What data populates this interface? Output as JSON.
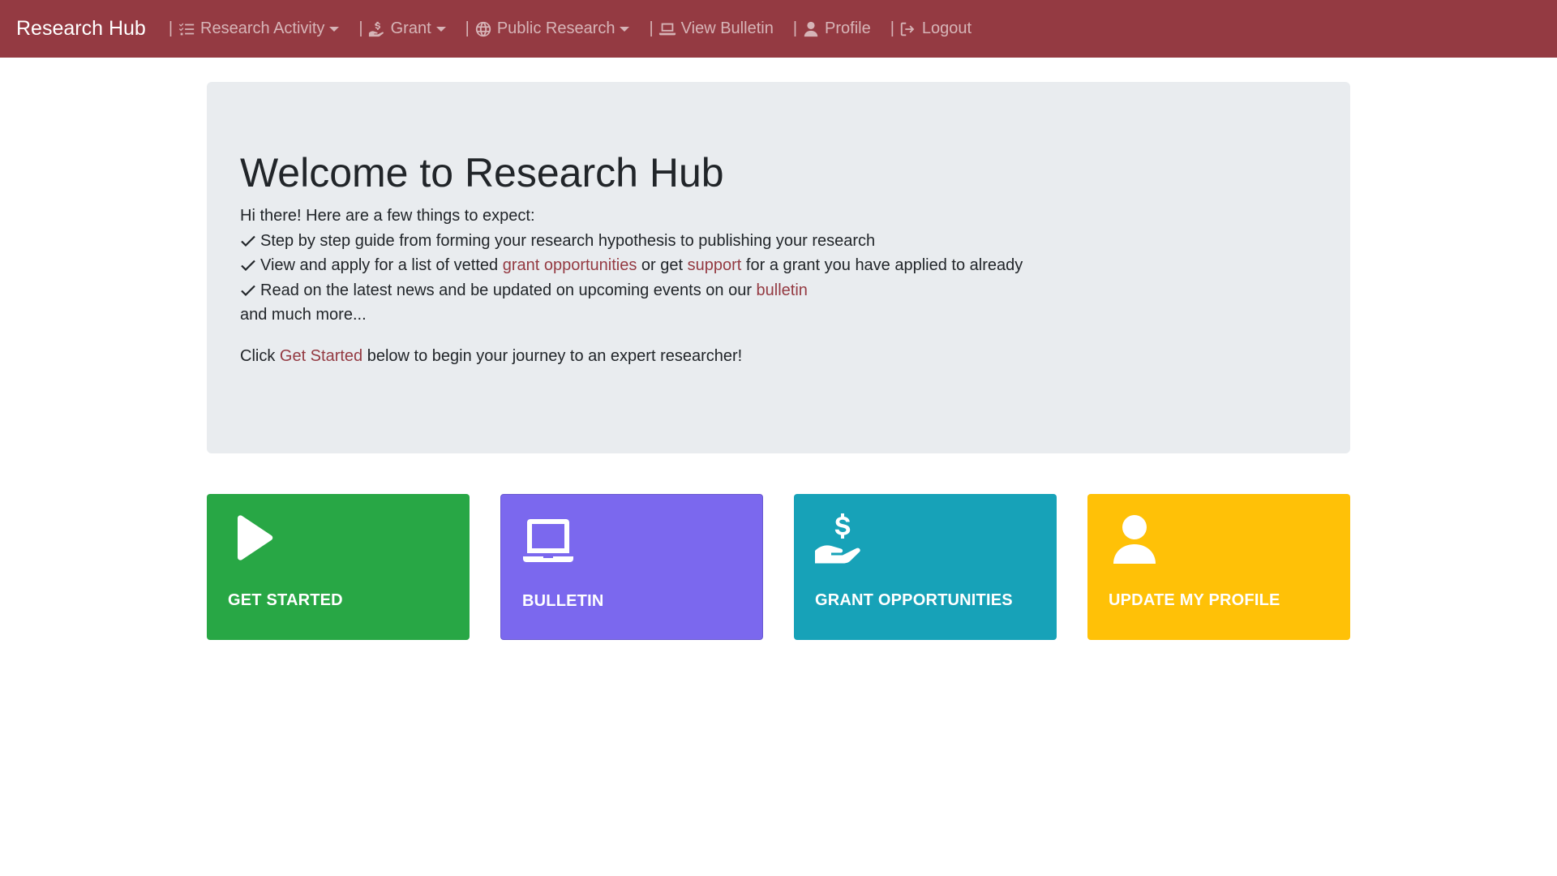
{
  "navbar": {
    "brand": "Research Hub",
    "separator": "|",
    "items": [
      {
        "label": "Research Activity",
        "icon": "list-check-icon",
        "dropdown": true
      },
      {
        "label": "Grant",
        "icon": "hand-dollar-icon",
        "dropdown": true
      },
      {
        "label": "Public Research",
        "icon": "globe-icon",
        "dropdown": true
      },
      {
        "label": "View Bulletin",
        "icon": "laptop-icon",
        "dropdown": false
      },
      {
        "label": "Profile",
        "icon": "user-icon",
        "dropdown": false
      },
      {
        "label": "Logout",
        "icon": "logout-icon",
        "dropdown": false
      }
    ]
  },
  "hero": {
    "title": "Welcome to Research Hub",
    "intro": "Hi there! Here are a few things to expect:",
    "bullet1": "Step by step guide from forming your research hypothesis to publishing your research",
    "bullet2_pre": "View and apply for a list of vetted ",
    "bullet2_link1": "grant opportunities",
    "bullet2_mid": " or get ",
    "bullet2_link2": "support",
    "bullet2_post": " for a grant you have applied to already",
    "bullet3_pre": "Read on the latest news and be updated on upcoming events on our ",
    "bullet3_link": "bulletin",
    "more": "and much more...",
    "cta_pre": "Click ",
    "cta_link": "Get Started",
    "cta_post": " below to begin your journey to an expert researcher!"
  },
  "cards": [
    {
      "label": "GET STARTED",
      "icon": "play-icon",
      "color": "#28a745"
    },
    {
      "label": "BULLETIN",
      "icon": "laptop-icon",
      "color": "#7b68ee"
    },
    {
      "label": "GRANT OPPORTUNITIES",
      "icon": "hand-dollar-icon",
      "color": "#17a2b8"
    },
    {
      "label": "UPDATE MY PROFILE",
      "icon": "user-icon",
      "color": "#ffc107"
    }
  ],
  "colors": {
    "navbar": "#943a42",
    "link": "#943a42",
    "jumbotron": "#e9ecef"
  }
}
